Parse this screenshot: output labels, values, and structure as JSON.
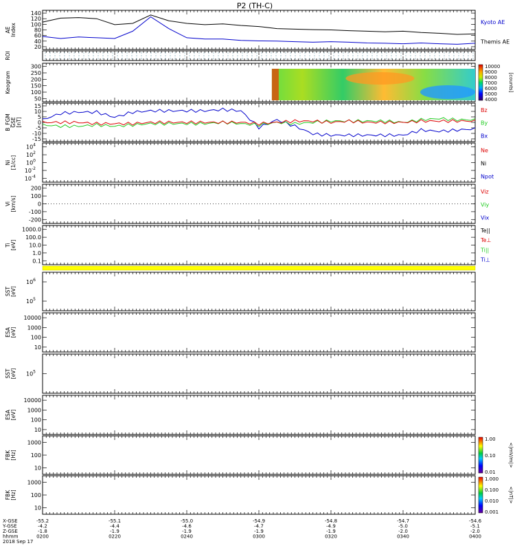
{
  "title": "P2 (TH-C)",
  "colors": {
    "black": "#000000",
    "blue": "#0000cc",
    "red": "#dd0000",
    "green": "#22cc22",
    "roi_yellow": "#ffff00",
    "dots": "#6699aa"
  },
  "chart_data": [
    {
      "type": "line",
      "panel": "ae",
      "ylabel": "AE Index",
      "yticks": [
        "20",
        "40",
        "60",
        "80",
        "100",
        "120",
        "140"
      ],
      "ylim": [
        0,
        150
      ],
      "legend": [
        "Kyoto AE",
        "Themis AE"
      ],
      "x": [
        "0200",
        "0205",
        "0210",
        "0215",
        "0220",
        "0225",
        "0230",
        "0235",
        "0240",
        "0245",
        "0250",
        "0255",
        "0300",
        "0305",
        "0310",
        "0315",
        "0320",
        "0325",
        "0330",
        "0335",
        "0340",
        "0345",
        "0350",
        "0355",
        "0400"
      ],
      "series": [
        {
          "name": "Kyoto AE",
          "values": [
            105,
            120,
            122,
            118,
            95,
            100,
            132,
            110,
            100,
            95,
            98,
            92,
            88,
            80,
            78,
            76,
            75,
            72,
            70,
            68,
            70,
            65,
            62,
            58,
            60
          ]
        },
        {
          "name": "Themis AE",
          "values": [
            50,
            42,
            48,
            45,
            42,
            70,
            125,
            80,
            45,
            40,
            40,
            35,
            33,
            32,
            30,
            28,
            30,
            28,
            25,
            24,
            22,
            25,
            22,
            20,
            24
          ]
        }
      ]
    },
    {
      "type": "heatmap",
      "panel": "roi",
      "ylabel": "ROI"
    },
    {
      "type": "heatmap",
      "panel": "keogram",
      "ylabel": "Keogram",
      "yticks": [
        "50",
        "100",
        "150",
        "200",
        "250",
        "300"
      ],
      "colorbar": {
        "label": "[counts]",
        "ticks": [
          "4000",
          "5000",
          "6000",
          "7000",
          "8000",
          "9000",
          "10000"
        ]
      }
    },
    {
      "type": "line",
      "panel": "bfgm",
      "ylabel": "B_FGM GSE [nT]",
      "yticks": [
        "-15",
        "-10",
        "-5",
        "0",
        "5",
        "10",
        "15"
      ],
      "ylim": [
        -15,
        15
      ],
      "legend": [
        "Bz",
        "By",
        "Bx"
      ],
      "x": [
        "0200",
        "0205",
        "0210",
        "0215",
        "0220",
        "0225",
        "0230",
        "0235",
        "0240",
        "0245",
        "0250",
        "0255",
        "0300",
        "0305",
        "0310",
        "0315",
        "0320",
        "0325",
        "0330",
        "0335",
        "0340",
        "0345",
        "0350",
        "0355",
        "0400"
      ],
      "series": [
        {
          "name": "Bx",
          "values": [
            2,
            7,
            8,
            8,
            4,
            8,
            9,
            9,
            9,
            9,
            10,
            9,
            -4,
            2,
            -3,
            -9,
            -10,
            -10,
            -10,
            -10,
            -10,
            -6,
            -7,
            -6,
            -5
          ]
        },
        {
          "name": "By",
          "values": [
            -2,
            -3,
            -3,
            -2,
            -3,
            -2,
            -1,
            -1,
            -1,
            -1,
            0,
            -1,
            -2,
            0,
            -1,
            0,
            1,
            1,
            1,
            1,
            0,
            2,
            3,
            2,
            2
          ]
        },
        {
          "name": "Bz",
          "values": [
            0,
            0,
            0,
            -1,
            -1,
            -1,
            0,
            0,
            0,
            0,
            0,
            0,
            -1,
            0,
            1,
            1,
            0,
            1,
            0,
            0,
            0,
            1,
            1,
            1,
            1
          ]
        }
      ]
    },
    {
      "type": "line",
      "panel": "density",
      "ylabel": "Ni [1/cc]",
      "yticks": [
        "10^-4",
        "10^-2",
        "10^0",
        "10^2",
        "10^4"
      ],
      "legend": [
        "Ne",
        "Ni",
        "Npot"
      ]
    },
    {
      "type": "line",
      "panel": "velocity",
      "ylabel": "Vi [km/s]",
      "yticks": [
        "-200",
        "-100",
        "0",
        "100",
        "200"
      ],
      "ylim": [
        -200,
        200
      ],
      "legend": [
        "Viz",
        "Viy",
        "Vix"
      ]
    },
    {
      "type": "line",
      "panel": "temperature",
      "ylabel": "Ti [eV]",
      "yticks": [
        "0.1",
        "1.0",
        "10.0",
        "100.0",
        "1000.0"
      ],
      "legend": [
        "Te||",
        "Te⊥",
        "Ti||",
        "Ti⊥"
      ]
    },
    {
      "type": "heatmap",
      "panel": "sst_ion",
      "ylabel": "SST [eV]",
      "yticks": [
        "10^5",
        "10^6"
      ]
    },
    {
      "type": "heatmap",
      "panel": "esa_ion",
      "ylabel": "ESA [eV]",
      "yticks": [
        "10",
        "100",
        "1000",
        "10000"
      ]
    },
    {
      "type": "heatmap",
      "panel": "sst_elec",
      "ylabel": "SST [eV]",
      "yticks": [
        "10^5"
      ]
    },
    {
      "type": "heatmap",
      "panel": "esa_elec",
      "ylabel": "ESA [eV]",
      "yticks": [
        "10",
        "100",
        "1000",
        "10000"
      ]
    },
    {
      "type": "heatmap",
      "panel": "fbk_b",
      "ylabel": "FBK [Hz]",
      "yticks": [
        "10",
        "100",
        "1000"
      ],
      "colorbar": {
        "label": "<|mV/m|>",
        "ticks": [
          "0.01",
          "0.10",
          "1.00"
        ]
      }
    },
    {
      "type": "heatmap",
      "panel": "fbk_e",
      "ylabel": "FBK [Hz]",
      "yticks": [
        "10",
        "100",
        "1000"
      ],
      "colorbar": {
        "label": "<|nT|>",
        "ticks": [
          "0.001",
          "0.010",
          "0.100",
          "1.000"
        ]
      }
    }
  ],
  "xaxis": {
    "row_labels": [
      "X-GSE",
      "Y-GSE",
      "Z-GSE",
      "hhmm",
      "2018 Sep 17"
    ],
    "ticks": [
      {
        "x": "-55.2",
        "y": "-4.2",
        "z": "-1.8",
        "t": "0200"
      },
      {
        "x": "-55.1",
        "y": "-4.4",
        "z": "-1.9",
        "t": "0220"
      },
      {
        "x": "-55.0",
        "y": "-4.6",
        "z": "-1.9",
        "t": "0240"
      },
      {
        "x": "-54.9",
        "y": "-4.7",
        "z": "-1.9",
        "t": "0300"
      },
      {
        "x": "-54.8",
        "y": "-4.9",
        "z": "-1.9",
        "t": "0320"
      },
      {
        "x": "-54.7",
        "y": "-5.0",
        "z": "-2.0",
        "t": "0340"
      },
      {
        "x": "-54.6",
        "y": "-5.1",
        "z": "-2.0",
        "t": "0400"
      }
    ]
  }
}
